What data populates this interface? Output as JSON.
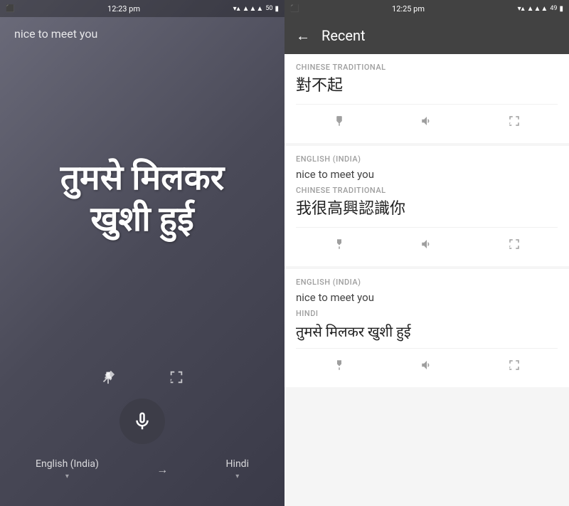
{
  "left": {
    "status_bar": {
      "time": "12:23 pm",
      "photo_icon": "photo",
      "wifi": "wifi",
      "signal": "signal",
      "battery": "50"
    },
    "input_text": "nice to meet you",
    "translated_text": "तुमसे मिलकर\nखुशी हुई",
    "pin_icon": "pin",
    "expand_icon": "expand",
    "mic_icon": "microphone",
    "language_from": "English (India)",
    "arrow": "→",
    "language_to": "Hindi",
    "dropdown_arrow": "▾"
  },
  "right": {
    "status_bar": {
      "time": "12:25 pm",
      "photo_icon": "photo",
      "wifi": "wifi",
      "signal": "signal",
      "battery": "49"
    },
    "toolbar": {
      "back_label": "←",
      "title": "Recent"
    },
    "cards": [
      {
        "lang_label": "CHINESE TRADITIONAL",
        "text_main": "對不起",
        "text_source": null,
        "lang_label_source": null,
        "actions": [
          "pin",
          "sound",
          "expand"
        ]
      },
      {
        "lang_label_source": "ENGLISH (INDIA)",
        "text_source": "nice to meet you",
        "lang_label": "CHINESE TRADITIONAL",
        "text_main": "我很高興認識你",
        "actions": [
          "pin",
          "sound",
          "expand"
        ]
      },
      {
        "lang_label_source": "ENGLISH (INDIA)",
        "text_source": "nice to meet you",
        "lang_label": "HINDI",
        "text_main": "तुमसे मिलकर खुशी हुई",
        "actions": [
          "pin",
          "sound",
          "expand"
        ]
      }
    ]
  }
}
